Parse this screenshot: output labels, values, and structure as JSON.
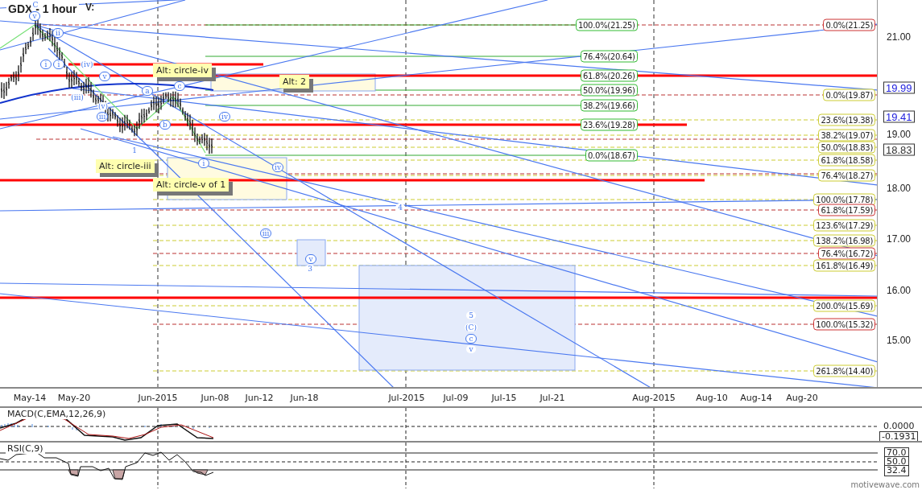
{
  "title": "GDX - 1 hour",
  "subtitle": "V:",
  "fib_labels": [
    {
      "text": "100.0%(21.25)",
      "color": "#33bb33"
    },
    {
      "text": "76.4%(20.64)",
      "color": "#33bb33"
    },
    {
      "text": "61.8%(20.26)",
      "color": "#33bb33"
    },
    {
      "text": "50.0%(19.96)",
      "color": "#33bb33"
    },
    {
      "text": "38.2%(19.66)",
      "color": "#33bb33"
    },
    {
      "text": "23.6%(19.28)",
      "color": "#33bb33"
    },
    {
      "text": "0.0%(18.67)",
      "color": "#33bb33"
    },
    {
      "text": "0.0%(21.25)",
      "color": "#cc3333"
    },
    {
      "text": "0.0%(19.87)",
      "color": "#cccc33"
    },
    {
      "text": "23.6%(19.38)",
      "color": "#cccc33"
    },
    {
      "text": "38.2%(19.07)",
      "color": "#cccc33"
    },
    {
      "text": "50.0%(18.83)",
      "color": "#cccc33"
    },
    {
      "text": "61.8%(18.58)",
      "color": "#cccc33"
    },
    {
      "text": "76.4%(18.27)",
      "color": "#cccc33"
    },
    {
      "text": "100.0%(17.78)",
      "color": "#cccc33"
    },
    {
      "text": "61.8%(17.59)",
      "color": "#cc3333"
    },
    {
      "text": "123.6%(17.29)",
      "color": "#cccc33"
    },
    {
      "text": "138.2%(16.98)",
      "color": "#cccc33"
    },
    {
      "text": "76.4%(16.72)",
      "color": "#cc3333"
    },
    {
      "text": "161.8%(16.49)",
      "color": "#cccc33"
    },
    {
      "text": "200.0%(15.69)",
      "color": "#cccc33"
    },
    {
      "text": "100.0%(15.32)",
      "color": "#cc3333"
    },
    {
      "text": "261.8%(14.40)",
      "color": "#cccc33"
    }
  ],
  "notes": [
    "Alt: circle-iv",
    "Alt: 2",
    "Alt: circle-iii",
    "Alt: circle-v of 1"
  ],
  "wave_labels": [
    {
      "text": "C",
      "circled": false
    },
    {
      "text": "v",
      "circled": true
    },
    {
      "text": "ii",
      "circled": true
    },
    {
      "text": "i",
      "circled": true
    },
    {
      "text": "i",
      "circled": true
    },
    {
      "text": "(iv)",
      "circled": false
    },
    {
      "text": "(iii)",
      "circled": false
    },
    {
      "text": "v",
      "circled": true
    },
    {
      "text": "(v)",
      "circled": false
    },
    {
      "text": "iii",
      "circled": true
    },
    {
      "text": "a",
      "circled": true
    },
    {
      "text": "b",
      "circled": true
    },
    {
      "text": "c",
      "circled": true
    },
    {
      "text": "1",
      "circled": false
    },
    {
      "text": "iv",
      "circled": true
    },
    {
      "text": "i",
      "circled": true
    },
    {
      "text": "iv",
      "circled": true
    },
    {
      "text": "iii",
      "circled": true
    },
    {
      "text": "v",
      "circled": true
    },
    {
      "text": "3",
      "circled": false
    },
    {
      "text": "4",
      "circled": false
    },
    {
      "text": "5",
      "circled": false
    },
    {
      "text": "(C)",
      "circled": false
    },
    {
      "text": "c",
      "circled": true
    },
    {
      "text": "v",
      "circled": false
    }
  ],
  "price_axis": {
    "ticks": [
      "21.00",
      "19.00",
      "18.00",
      "17.00",
      "16.00",
      "15.00"
    ],
    "badges": [
      {
        "text": "19.99",
        "color": "#2222dd"
      },
      {
        "text": "19.41",
        "color": "#2222dd"
      },
      {
        "text": "18.83",
        "color": "#333333"
      }
    ]
  },
  "time_axis": [
    "May-14",
    "May-20",
    "Jun-2015",
    "Jun-08",
    "Jun-12",
    "Jun-18",
    "Jul-2015",
    "Jul-09",
    "Jul-15",
    "Jul-21",
    "Aug-2015",
    "Aug-10",
    "Aug-14",
    "Aug-20"
  ],
  "macd": {
    "title": "MACD(C,EMA,12,26,9)",
    "tick": "0.0000",
    "badge": "-0.1931"
  },
  "rsi": {
    "title": "RSI(C,9)",
    "badges": [
      "70.0",
      "50.0",
      "32.4"
    ]
  },
  "brand": "motivewave.com"
}
